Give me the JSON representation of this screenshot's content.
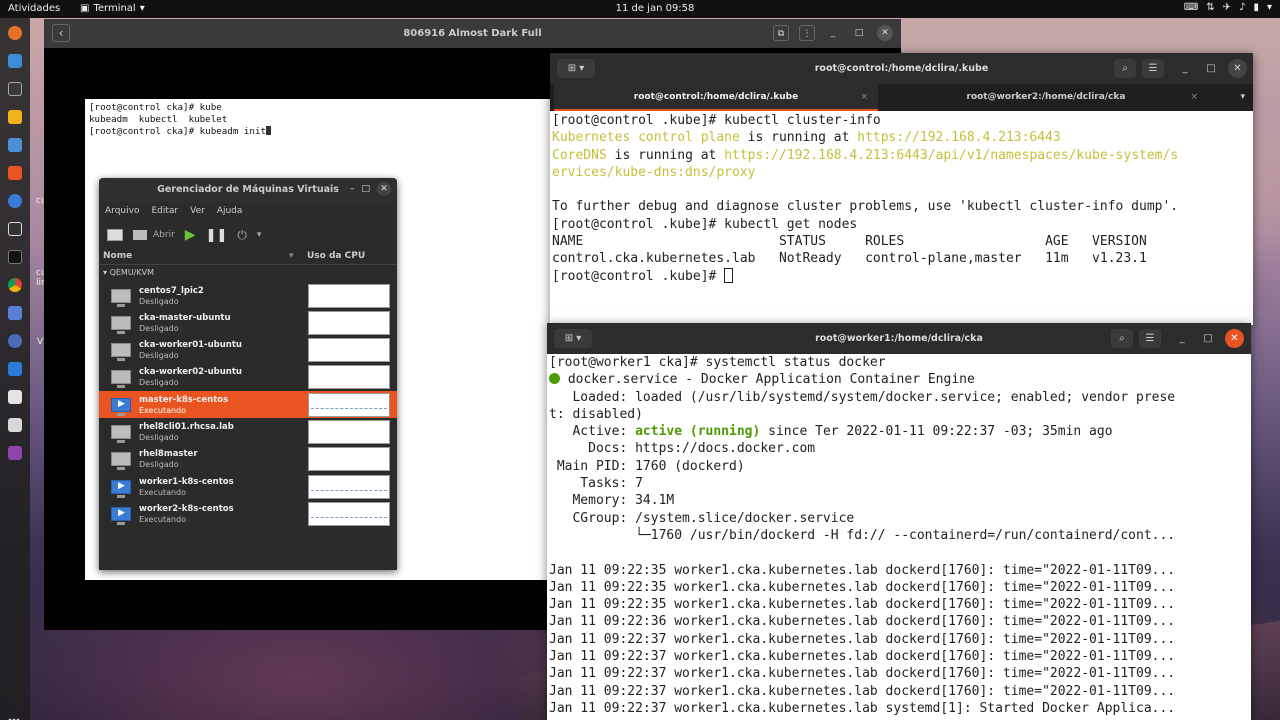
{
  "topbar": {
    "activities": "Atividades",
    "app_menu": "Terminal",
    "clock": "11 de jan  09:58"
  },
  "desktop_labels": [
    "cu",
    "cu",
    "lir",
    "V"
  ],
  "window_main": {
    "title": "806916 Almost Dark Full",
    "vm_terminal_lines": [
      "[root@control cka]# kube",
      "kubeadm  kubectl  kubelet",
      "[root@control cka]# kubeadm init"
    ]
  },
  "vm_manager": {
    "title": "Gerenciador de Máquinas Virtuais",
    "menu": [
      "Arquivo",
      "Editar",
      "Ver",
      "Ajuda"
    ],
    "open_label": "Abrir",
    "col_name": "Nome",
    "col_cpu": "Uso da CPU",
    "group": "QEMU/KVM",
    "vms": [
      {
        "name": "centos7_lpic2",
        "state": "Desligado",
        "running": false
      },
      {
        "name": "cka-master-ubuntu",
        "state": "Desligado",
        "running": false
      },
      {
        "name": "cka-worker01-ubuntu",
        "state": "Desligado",
        "running": false
      },
      {
        "name": "cka-worker02-ubuntu",
        "state": "Desligado",
        "running": false
      },
      {
        "name": "master-k8s-centos",
        "state": "Executando",
        "running": true,
        "selected": true
      },
      {
        "name": "rhel8cli01.rhcsa.lab",
        "state": "Desligado",
        "running": false
      },
      {
        "name": "rhel8master",
        "state": "Desligado",
        "running": false
      },
      {
        "name": "worker1-k8s-centos",
        "state": "Executando",
        "running": true
      },
      {
        "name": "worker2-k8s-centos",
        "state": "Executando",
        "running": true
      }
    ]
  },
  "window_control": {
    "title": "root@control:/home/dclira/.kube",
    "tabs": [
      "root@control:/home/dclira/.kube",
      "root@worker2:/home/dclira/cka"
    ],
    "lines": [
      "[root@control .kube]# kubectl cluster-info",
      "Kubernetes control plane is running at https://192.168.4.213:6443",
      "CoreDNS is running at https://192.168.4.213:6443/api/v1/namespaces/kube-system/s",
      "ervices/kube-dns:dns/proxy",
      "",
      "To further debug and diagnose cluster problems, use 'kubectl cluster-info dump'.",
      "[root@control .kube]# kubectl get nodes",
      "NAME                         STATUS     ROLES                  AGE   VERSION",
      "control.cka.kubernetes.lab   NotReady   control-plane,master   11m   v1.23.1",
      "[root@control .kube]# "
    ]
  },
  "window_worker1": {
    "title": "root@worker1:/home/dclira/cka",
    "lines": [
      "[root@worker1 cka]# systemctl status docker",
      " docker.service - Docker Application Container Engine",
      "   Loaded: loaded (/usr/lib/systemd/system/docker.service; enabled; vendor prese",
      "t: disabled)",
      "   Active: active (running) since Ter 2022-01-11 09:22:37 -03; 35min ago",
      "     Docs: https://docs.docker.com",
      " Main PID: 1760 (dockerd)",
      "    Tasks: 7",
      "   Memory: 34.1M",
      "   CGroup: /system.slice/docker.service",
      "           └─1760 /usr/bin/dockerd -H fd:// --containerd=/run/containerd/cont...",
      "",
      "Jan 11 09:22:35 worker1.cka.kubernetes.lab dockerd[1760]: time=\"2022-01-11T09...",
      "Jan 11 09:22:35 worker1.cka.kubernetes.lab dockerd[1760]: time=\"2022-01-11T09...",
      "Jan 11 09:22:35 worker1.cka.kubernetes.lab dockerd[1760]: time=\"2022-01-11T09...",
      "Jan 11 09:22:36 worker1.cka.kubernetes.lab dockerd[1760]: time=\"2022-01-11T09...",
      "Jan 11 09:22:37 worker1.cka.kubernetes.lab dockerd[1760]: time=\"2022-01-11T09...",
      "Jan 11 09:22:37 worker1.cka.kubernetes.lab dockerd[1760]: time=\"2022-01-11T09...",
      "Jan 11 09:22:37 worker1.cka.kubernetes.lab dockerd[1760]: time=\"2022-01-11T09...",
      "Jan 11 09:22:37 worker1.cka.kubernetes.lab dockerd[1760]: time=\"2022-01-11T09...",
      "Jan 11 09:22:37 worker1.cka.kubernetes.lab systemd[1]: Started Docker Applica..."
    ]
  },
  "colors": {
    "accent": "#e95420",
    "running_green": "#4e9a06",
    "url_yellow": "#c3c13a"
  }
}
